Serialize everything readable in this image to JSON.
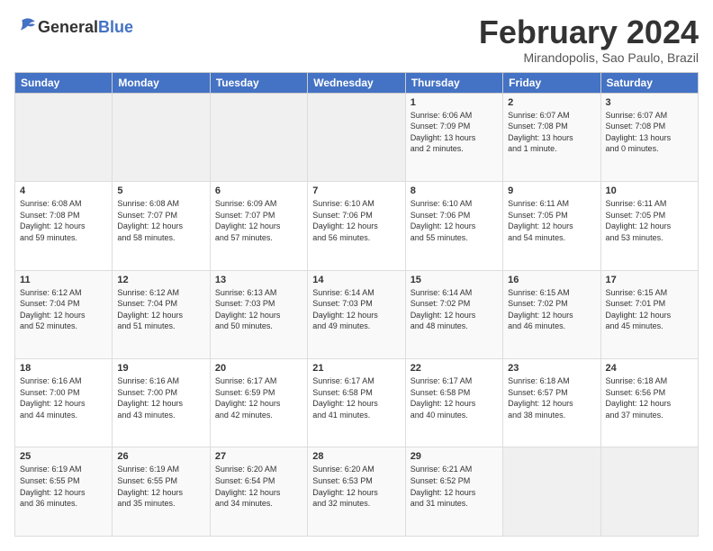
{
  "logo": {
    "general": "General",
    "blue": "Blue"
  },
  "title": "February 2024",
  "location": "Mirandopolis, Sao Paulo, Brazil",
  "headers": [
    "Sunday",
    "Monday",
    "Tuesday",
    "Wednesday",
    "Thursday",
    "Friday",
    "Saturday"
  ],
  "weeks": [
    [
      {
        "day": "",
        "info": ""
      },
      {
        "day": "",
        "info": ""
      },
      {
        "day": "",
        "info": ""
      },
      {
        "day": "",
        "info": ""
      },
      {
        "day": "1",
        "info": "Sunrise: 6:06 AM\nSunset: 7:09 PM\nDaylight: 13 hours\nand 2 minutes."
      },
      {
        "day": "2",
        "info": "Sunrise: 6:07 AM\nSunset: 7:08 PM\nDaylight: 13 hours\nand 1 minute."
      },
      {
        "day": "3",
        "info": "Sunrise: 6:07 AM\nSunset: 7:08 PM\nDaylight: 13 hours\nand 0 minutes."
      }
    ],
    [
      {
        "day": "4",
        "info": "Sunrise: 6:08 AM\nSunset: 7:08 PM\nDaylight: 12 hours\nand 59 minutes."
      },
      {
        "day": "5",
        "info": "Sunrise: 6:08 AM\nSunset: 7:07 PM\nDaylight: 12 hours\nand 58 minutes."
      },
      {
        "day": "6",
        "info": "Sunrise: 6:09 AM\nSunset: 7:07 PM\nDaylight: 12 hours\nand 57 minutes."
      },
      {
        "day": "7",
        "info": "Sunrise: 6:10 AM\nSunset: 7:06 PM\nDaylight: 12 hours\nand 56 minutes."
      },
      {
        "day": "8",
        "info": "Sunrise: 6:10 AM\nSunset: 7:06 PM\nDaylight: 12 hours\nand 55 minutes."
      },
      {
        "day": "9",
        "info": "Sunrise: 6:11 AM\nSunset: 7:05 PM\nDaylight: 12 hours\nand 54 minutes."
      },
      {
        "day": "10",
        "info": "Sunrise: 6:11 AM\nSunset: 7:05 PM\nDaylight: 12 hours\nand 53 minutes."
      }
    ],
    [
      {
        "day": "11",
        "info": "Sunrise: 6:12 AM\nSunset: 7:04 PM\nDaylight: 12 hours\nand 52 minutes."
      },
      {
        "day": "12",
        "info": "Sunrise: 6:12 AM\nSunset: 7:04 PM\nDaylight: 12 hours\nand 51 minutes."
      },
      {
        "day": "13",
        "info": "Sunrise: 6:13 AM\nSunset: 7:03 PM\nDaylight: 12 hours\nand 50 minutes."
      },
      {
        "day": "14",
        "info": "Sunrise: 6:14 AM\nSunset: 7:03 PM\nDaylight: 12 hours\nand 49 minutes."
      },
      {
        "day": "15",
        "info": "Sunrise: 6:14 AM\nSunset: 7:02 PM\nDaylight: 12 hours\nand 48 minutes."
      },
      {
        "day": "16",
        "info": "Sunrise: 6:15 AM\nSunset: 7:02 PM\nDaylight: 12 hours\nand 46 minutes."
      },
      {
        "day": "17",
        "info": "Sunrise: 6:15 AM\nSunset: 7:01 PM\nDaylight: 12 hours\nand 45 minutes."
      }
    ],
    [
      {
        "day": "18",
        "info": "Sunrise: 6:16 AM\nSunset: 7:00 PM\nDaylight: 12 hours\nand 44 minutes."
      },
      {
        "day": "19",
        "info": "Sunrise: 6:16 AM\nSunset: 7:00 PM\nDaylight: 12 hours\nand 43 minutes."
      },
      {
        "day": "20",
        "info": "Sunrise: 6:17 AM\nSunset: 6:59 PM\nDaylight: 12 hours\nand 42 minutes."
      },
      {
        "day": "21",
        "info": "Sunrise: 6:17 AM\nSunset: 6:58 PM\nDaylight: 12 hours\nand 41 minutes."
      },
      {
        "day": "22",
        "info": "Sunrise: 6:17 AM\nSunset: 6:58 PM\nDaylight: 12 hours\nand 40 minutes."
      },
      {
        "day": "23",
        "info": "Sunrise: 6:18 AM\nSunset: 6:57 PM\nDaylight: 12 hours\nand 38 minutes."
      },
      {
        "day": "24",
        "info": "Sunrise: 6:18 AM\nSunset: 6:56 PM\nDaylight: 12 hours\nand 37 minutes."
      }
    ],
    [
      {
        "day": "25",
        "info": "Sunrise: 6:19 AM\nSunset: 6:55 PM\nDaylight: 12 hours\nand 36 minutes."
      },
      {
        "day": "26",
        "info": "Sunrise: 6:19 AM\nSunset: 6:55 PM\nDaylight: 12 hours\nand 35 minutes."
      },
      {
        "day": "27",
        "info": "Sunrise: 6:20 AM\nSunset: 6:54 PM\nDaylight: 12 hours\nand 34 minutes."
      },
      {
        "day": "28",
        "info": "Sunrise: 6:20 AM\nSunset: 6:53 PM\nDaylight: 12 hours\nand 32 minutes."
      },
      {
        "day": "29",
        "info": "Sunrise: 6:21 AM\nSunset: 6:52 PM\nDaylight: 12 hours\nand 31 minutes."
      },
      {
        "day": "",
        "info": ""
      },
      {
        "day": "",
        "info": ""
      }
    ]
  ]
}
